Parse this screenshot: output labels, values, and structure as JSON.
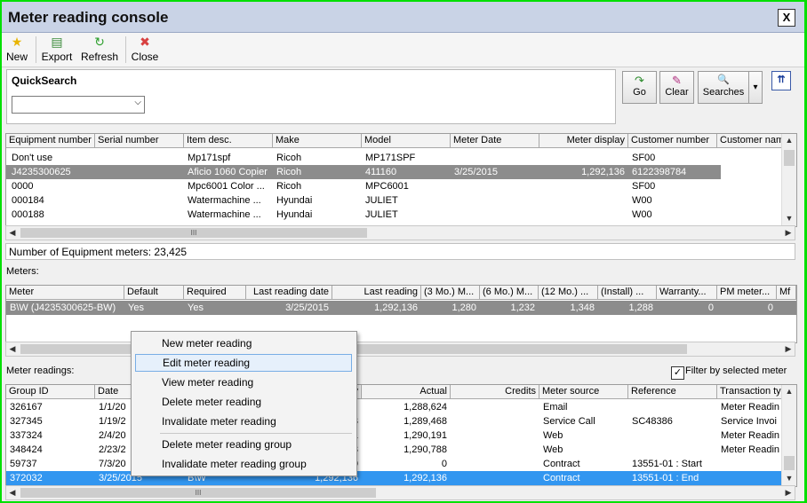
{
  "window": {
    "title": "Meter reading console",
    "close": "X"
  },
  "toolbar": [
    {
      "label": "New",
      "icon": "★",
      "color": "#e8b400"
    },
    {
      "label": "Export",
      "icon": "▤",
      "color": "#3a8a3a"
    },
    {
      "label": "Refresh",
      "icon": "↻",
      "color": "#2ea02e"
    },
    {
      "label": "Close",
      "icon": "✖",
      "color": "#d84040"
    }
  ],
  "quicksearch": {
    "label": "QuickSearch",
    "value": ""
  },
  "search_buttons": {
    "go": "Go",
    "clear": "Clear",
    "searches": "Searches",
    "go_icon": "↷",
    "clear_icon": "✎",
    "searches_icon": "🔍",
    "collapse_icon": "⇈",
    "menu_icon": "▾"
  },
  "equipment": {
    "columns": [
      "Equipment number",
      "Serial number",
      "Item desc.",
      "Make",
      "Model",
      "Meter Date",
      "Meter display",
      "Customer number",
      "Customer nam"
    ],
    "rows": [
      [
        "Don't use",
        "",
        "Mp171spf",
        "Ricoh",
        "MP171SPF",
        "",
        "",
        "SF00",
        ""
      ],
      [
        "J4235300625",
        "",
        "Aficio 1060 Copier",
        "Ricoh",
        "411160",
        "3/25/2015",
        "1,292,136",
        "6122398784",
        ""
      ],
      [
        "0000",
        "",
        "Mpc6001 Color ...",
        "Ricoh",
        "MPC6001",
        "",
        "",
        "SF00",
        ""
      ],
      [
        "000184",
        "",
        "Watermachine ...",
        "Hyundai",
        "JULIET",
        "",
        "",
        "W00",
        ""
      ],
      [
        "000188",
        "",
        "Watermachine ...",
        "Hyundai",
        "JULIET",
        "",
        "",
        "W00",
        ""
      ]
    ],
    "count_text": "Number of Equipment meters: 23,425"
  },
  "meters": {
    "label": "Meters:",
    "columns": [
      "Meter",
      "Default",
      "Required",
      "Last reading date",
      "Last reading",
      "(3 Mo.) M...",
      "(6 Mo.) M...",
      "(12 Mo.) ...",
      "(Install) ...",
      "Warranty...",
      "PM meter...",
      "Mf"
    ],
    "rows": [
      [
        "B\\W (J4235300625-BW)",
        "Yes",
        "Yes",
        "3/25/2015",
        "1,292,136",
        "1,280",
        "1,232",
        "1,348",
        "1,288",
        "0",
        "0",
        ""
      ]
    ]
  },
  "readings": {
    "label": "Meter readings:",
    "filter_label": "Filter by selected meter",
    "filter_checked": true,
    "columns": [
      "Group ID",
      "Date",
      "",
      "y",
      "Actual",
      "Credits",
      "Meter source",
      "Reference",
      "Transaction ty"
    ],
    "rows": [
      [
        "326167",
        "1/1/20",
        "",
        "",
        "1,288,624",
        "",
        "Email",
        "",
        "Meter Readin"
      ],
      [
        "327345",
        "1/19/2",
        "",
        "3",
        "1,289,468",
        "",
        "Service Call",
        "SC48386",
        "Service Invoi"
      ],
      [
        "337324",
        "2/4/20",
        "",
        "1",
        "1,290,191",
        "",
        "Web",
        "",
        "Meter Readin"
      ],
      [
        "348424",
        "2/23/2",
        "",
        "3",
        "1,290,788",
        "",
        "Web",
        "",
        "Meter Readin"
      ],
      [
        "59737",
        "7/3/20",
        "",
        "0",
        "0",
        "",
        "Contract",
        "13551-01 : Start",
        ""
      ],
      [
        "372032",
        "3/25/2015",
        "B\\W",
        "1,292,136",
        "1,292,136",
        "",
        "Contract",
        "13551-01 : End",
        ""
      ]
    ]
  },
  "context_menu": [
    "New meter reading",
    "Edit meter reading",
    "View meter reading",
    "Delete meter reading",
    "Invalidate meter reading",
    "Delete meter reading group",
    "Invalidate meter reading group"
  ],
  "scroll": {
    "up": "▲",
    "down": "▼",
    "left": "◀",
    "right": "▶",
    "grip": "III"
  }
}
